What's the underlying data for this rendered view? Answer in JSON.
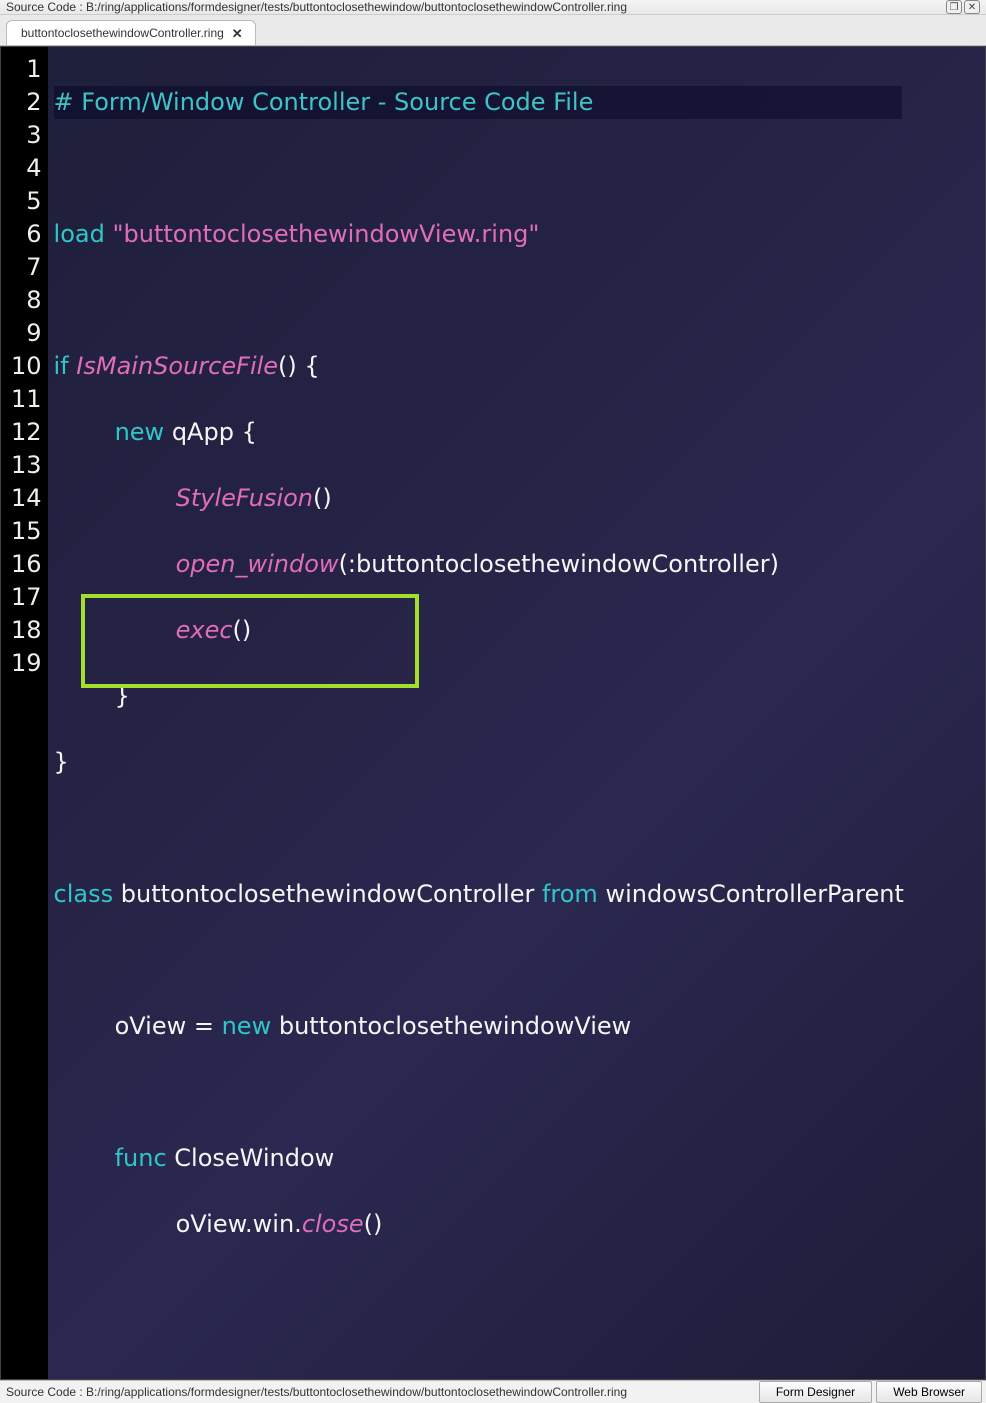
{
  "titlebar": {
    "label": "Source Code : B:/ring/applications/formdesigner/tests/buttontoclosethewindow/buttontoclosethewindowController.ring",
    "btn_restore": "❐",
    "btn_close": "✕"
  },
  "tab": {
    "label": "buttontoclosethewindowController.ring",
    "close": "✕"
  },
  "gutter": [
    "1",
    "2",
    "3",
    "4",
    "5",
    "6",
    "7",
    "8",
    "9",
    "10",
    "11",
    "12",
    "13",
    "14",
    "15",
    "16",
    "17",
    "18",
    "19"
  ],
  "code": {
    "l1_comment": "# Form/Window Controller - Source Code File",
    "l3_load": "load",
    "l3_str": " \"buttontoclosethewindowView.ring\"",
    "l5_if": "if",
    "l5_fn": " IsMainSourceFile",
    "l5_rest": "() {",
    "l6_new": "new",
    "l6_rest": " qApp {",
    "l7_fn": "StyleFusion",
    "l7_rest": "()",
    "l8_fn": "open_window",
    "l8_rest": "(:buttontoclosethewindowController)",
    "l9_fn": "exec",
    "l9_rest": "()",
    "l10": "        }",
    "l11": "}",
    "l13_class": "class",
    "l13_name": " buttontoclosethewindowController ",
    "l13_from": "from",
    "l13_parent": " windowsControllerParent",
    "l15_a": "        oView = ",
    "l15_new": "new",
    "l15_b": " buttontoclosethewindowView",
    "l17_func": "func",
    "l17_name": " CloseWindow",
    "l18_a": "                oView.win.",
    "l18_fn": "close",
    "l18_b": "()"
  },
  "statusbar": {
    "path": "Source Code : B:/ring/applications/formdesigner/tests/buttontoclosethewindow/buttontoclosethewindowController.ring",
    "btn_designer": "Form Designer",
    "btn_browser": "Web Browser"
  }
}
